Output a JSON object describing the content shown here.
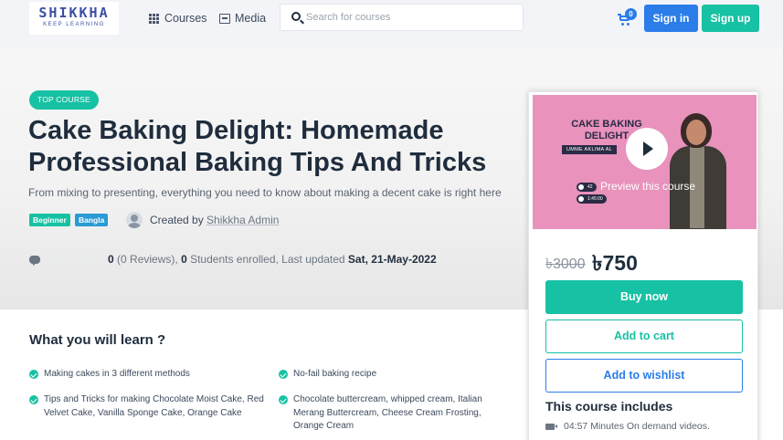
{
  "header": {
    "logo_word": "SHIKKHA",
    "logo_tagline": "KEEP LEARNING",
    "nav": {
      "courses": "Courses",
      "media": "Media"
    },
    "search_placeholder": "Search for courses",
    "cart_count": "0",
    "signin": "Sign in",
    "signup": "Sign up"
  },
  "course": {
    "badge": "TOP COURSE",
    "title": "Cake Baking Delight: Homemade Professional Baking Tips And Tricks",
    "subtitle": "From mixing to presenting, everything you need to know about making a decent cake is right here",
    "level": "Beginner",
    "language": "Bangla",
    "created_by_label": "Created by",
    "author": "Shikkha Admin",
    "rating_value": "0",
    "reviews": "(0 Reviews),",
    "students_count": "0",
    "students_label": "Students enrolled,",
    "last_updated_label": "Last updated",
    "last_updated": "Sat, 21-May-2022"
  },
  "card": {
    "thumb_title": "CAKE BAKING DELIGHT",
    "thumb_name": "UMME AKLIMA AL",
    "thumb_chip_1": "42",
    "thumb_chip_2": "1:45:00",
    "preview_text": "Preview this course",
    "price_old": "৳3000",
    "price_new": "৳750",
    "buy_now": "Buy now",
    "add_to_cart": "Add to cart",
    "add_to_wishlist": "Add to wishlist",
    "includes_title": "This course includes",
    "includes": [
      "04:57 Minutes On demand videos."
    ]
  },
  "learn": {
    "heading": "What you will learn ?",
    "items": [
      "Making cakes in 3 different methods",
      "No-fail baking recipe",
      "Tips and Tricks for making Chocolate Moist Cake, Red Velvet Cake, Vanilla Sponge Cake, Orange Cake",
      "Chocolate buttercream, whipped cream, Italian Merang Buttercream, Cheese Cream Frosting, Orange Cream"
    ]
  },
  "colors": {
    "primary_teal": "#17c1a3",
    "primary_blue": "#2b7de9",
    "language_tag": "#2a9bd4",
    "thumb_pink": "#e892bc"
  }
}
